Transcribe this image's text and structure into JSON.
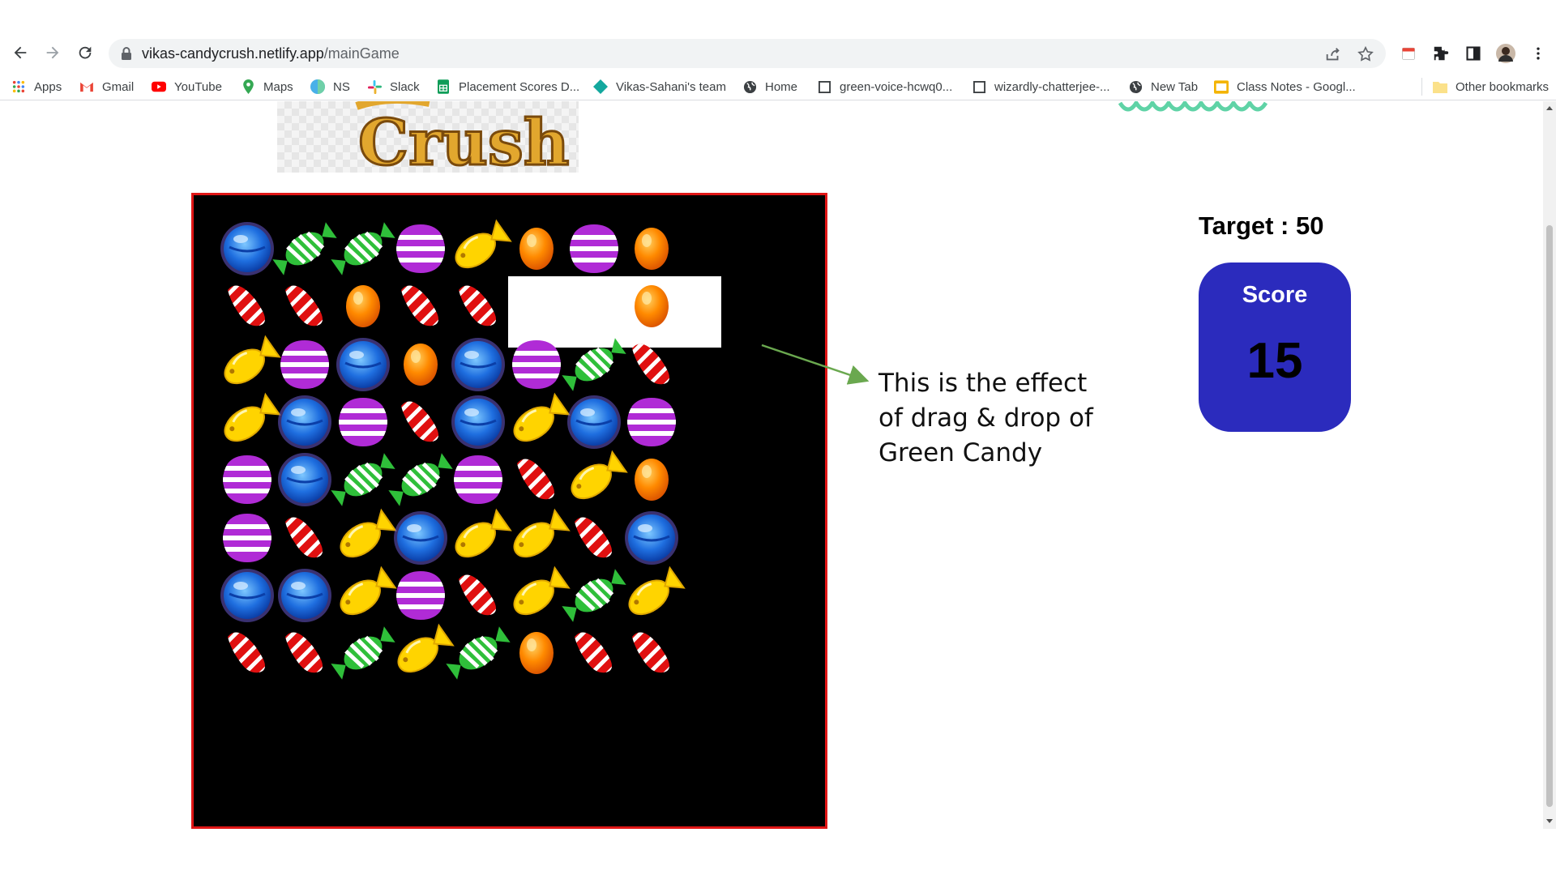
{
  "browser": {
    "url_host": "vikas-candycrush.netlify.app",
    "url_path": "/mainGame",
    "bookmarks": [
      {
        "label": "Apps",
        "icon": "apps-grid-icon"
      },
      {
        "label": "Gmail",
        "icon": "gmail-icon"
      },
      {
        "label": "YouTube",
        "icon": "youtube-icon"
      },
      {
        "label": "Maps",
        "icon": "maps-pin-icon"
      },
      {
        "label": "NS",
        "icon": "ns-icon"
      },
      {
        "label": "Slack",
        "icon": "slack-icon"
      },
      {
        "label": "Placement Scores D...",
        "icon": "sheets-icon"
      },
      {
        "label": "Vikas-Sahani's team",
        "icon": "diamond-icon"
      },
      {
        "label": "Home",
        "icon": "globe-icon"
      },
      {
        "label": "green-voice-hcwq0...",
        "icon": "page-icon"
      },
      {
        "label": "wizardly-chatterjee-...",
        "icon": "page-icon"
      },
      {
        "label": "New Tab",
        "icon": "globe-icon"
      },
      {
        "label": "Class Notes - Googl...",
        "icon": "slides-icon"
      }
    ],
    "other_bookmarks": "Other bookmarks"
  },
  "game": {
    "logo_text": "Crush",
    "target_text": "Target : 50",
    "score_label": "Score",
    "score_value": "15",
    "board_colors": {
      "border": "#e01616",
      "background": "#000000"
    },
    "candy_types": {
      "blue": "blue round candy",
      "green": "green striped wrapped candy",
      "purple": "purple striped candy",
      "yellow": "yellow fish candy",
      "orange": "orange jelly bean",
      "red": "red striped bean"
    },
    "grid": [
      [
        "blue",
        "green",
        "green",
        "purple",
        "yellow",
        "orange",
        "purple",
        "orange"
      ],
      [
        "red",
        "red",
        "orange",
        "red",
        "red",
        "blank",
        "blank",
        "orange"
      ],
      [
        "yellow",
        "purple",
        "blue",
        "orange",
        "blue",
        "purple",
        "green",
        "red"
      ],
      [
        "yellow",
        "blue",
        "purple",
        "red",
        "blue",
        "yellow",
        "blue",
        "purple"
      ],
      [
        "purple",
        "blue",
        "green",
        "green",
        "purple",
        "red",
        "yellow",
        "orange"
      ],
      [
        "purple",
        "red",
        "yellow",
        "blue",
        "yellow",
        "yellow",
        "red",
        "blue"
      ],
      [
        "blue",
        "blue",
        "yellow",
        "purple",
        "red",
        "yellow",
        "green",
        "yellow"
      ],
      [
        "red",
        "red",
        "green",
        "yellow",
        "green",
        "orange",
        "red",
        "red"
      ]
    ]
  },
  "annotation": {
    "text": "This is the effect\nof drag & drop of\nGreen Candy",
    "arrow_color": "#6aa84f"
  },
  "colors": {
    "score_box": "#2b2bbd",
    "accent_red": "#e01616"
  }
}
